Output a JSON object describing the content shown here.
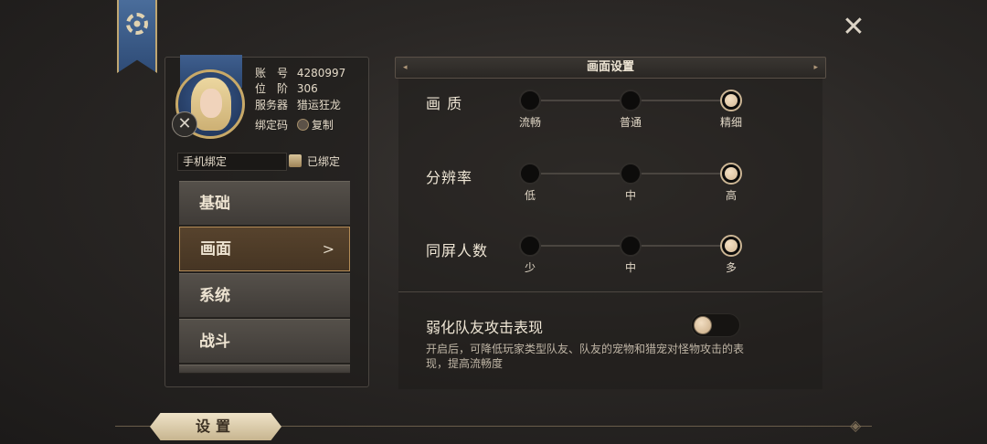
{
  "close_symbol": "✕",
  "profile": {
    "account_label": "账　号",
    "account_value": "4280997",
    "rank_label": "位　阶",
    "rank_value": "306",
    "server_label": "服务器",
    "server_value": "猎运狂龙",
    "bind_code_label": "绑定码",
    "copy_label": "复制"
  },
  "phone_bind": {
    "label": "手机绑定",
    "status": "已绑定"
  },
  "tabs": [
    {
      "label": "基础"
    },
    {
      "label": "画面",
      "active": true,
      "chevron": ">"
    },
    {
      "label": "系统"
    },
    {
      "label": "战斗"
    }
  ],
  "panel": {
    "title": "画面设置",
    "rows": [
      {
        "label": "画 质",
        "options": [
          "流畅",
          "普通",
          "精细"
        ],
        "selected": 2
      },
      {
        "label": "分辨率",
        "options": [
          "低",
          "中",
          "高"
        ],
        "selected": 2
      },
      {
        "label": "同屏人数",
        "options": [
          "少",
          "中",
          "多"
        ],
        "selected": 2
      }
    ],
    "weaken": {
      "title": "弱化队友攻击表现",
      "desc": "开启后，可降低玩家类型队友、队友的宠物和猎宠对怪物攻击的表现，提高流畅度",
      "enabled": false
    }
  },
  "footer": {
    "title": "设置"
  },
  "icons": [
    "gear-icon",
    "close-icon",
    "copy-icon",
    "scroll-icon",
    "chevron-right-icon"
  ]
}
